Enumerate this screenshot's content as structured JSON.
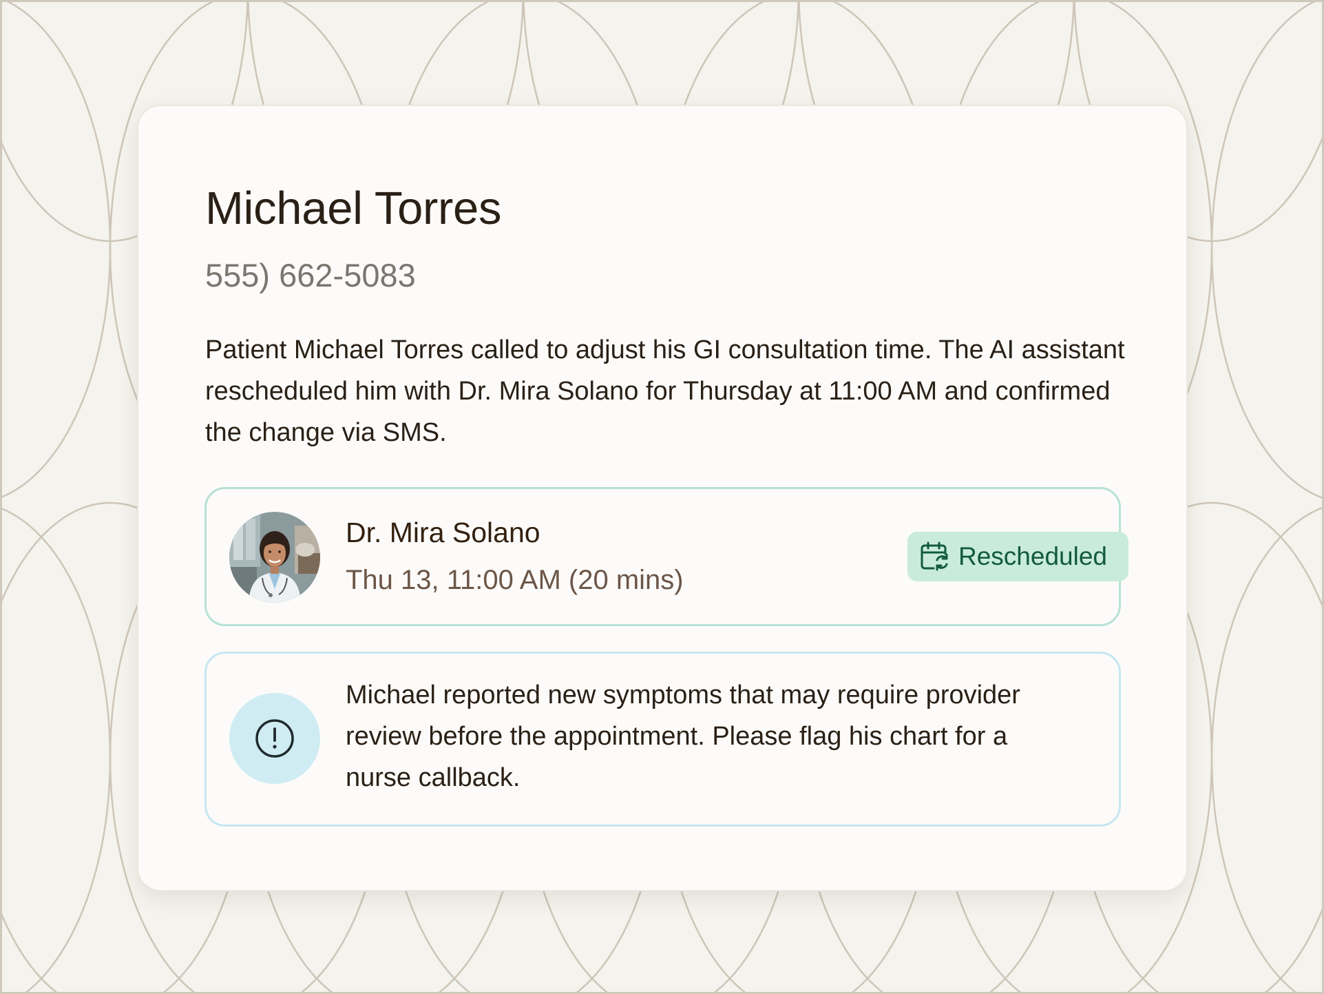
{
  "patient": {
    "name": "Michael Torres",
    "phone": "555) 662-5083"
  },
  "summary": "Patient Michael Torres called to adjust his GI consultation time. The AI assistant rescheduled him with Dr. Mira Solano for Thursday at 11:00 AM and confirmed the change via SMS.",
  "appointment": {
    "doctor_name": "Dr. Mira Solano",
    "time": "Thu 13, 11:00 AM (20 mins)",
    "status_label": "Rescheduled",
    "status_icon": "calendar-reschedule-icon",
    "status_color": "#125a3c",
    "status_bg": "#c8ebdc"
  },
  "alert": {
    "icon": "alert-circle-icon",
    "message": "Michael reported new symptoms that may require provider review before the appointment. Please flag his chart for a nurse callback."
  }
}
